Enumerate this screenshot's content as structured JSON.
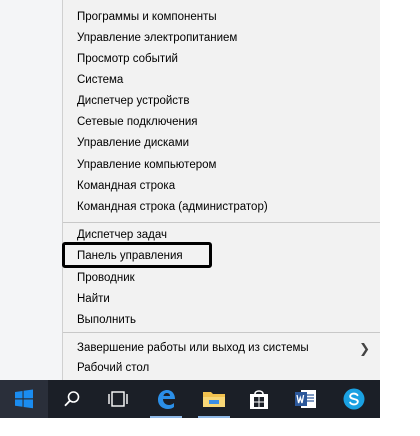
{
  "context_menu": {
    "group1": [
      "Программы и компоненты",
      "Управление электропитанием",
      "Просмотр событий",
      "Система",
      "Диспетчер устройств",
      "Сетевые подключения",
      "Управление дисками",
      "Управление компьютером",
      "Командная строка",
      "Командная строка (администратор)"
    ],
    "group2": [
      "Диспетчер задач",
      "Панель управления",
      "Проводник",
      "Найти",
      "Выполнить"
    ],
    "group3": [
      "Завершение работы или выход из системы",
      "Рабочий стол"
    ]
  },
  "taskbar": {
    "icons": [
      "windows-start-icon",
      "search-icon",
      "task-view-icon",
      "edge-icon",
      "file-explorer-icon",
      "store-icon",
      "word-icon",
      "skype-icon"
    ],
    "start_color": "#0078d7"
  }
}
